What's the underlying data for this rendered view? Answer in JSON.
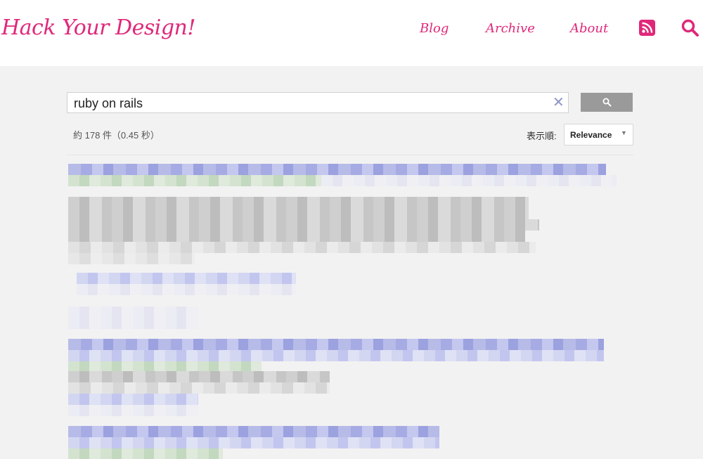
{
  "header": {
    "logo": "Hack Your Design!",
    "nav": {
      "blog": "Blog",
      "archive": "Archive",
      "about": "About"
    },
    "icons": {
      "rss": "rss-icon",
      "search": "search-icon"
    },
    "accent_color": "#e0287a"
  },
  "search": {
    "query": "ruby on rails",
    "clear_icon": "✕",
    "button_icon": "search-icon"
  },
  "results_meta": {
    "count_text": "約 178 件（0.45 秒）",
    "sort_label": "表示順:",
    "sort_value": "Relevance"
  }
}
